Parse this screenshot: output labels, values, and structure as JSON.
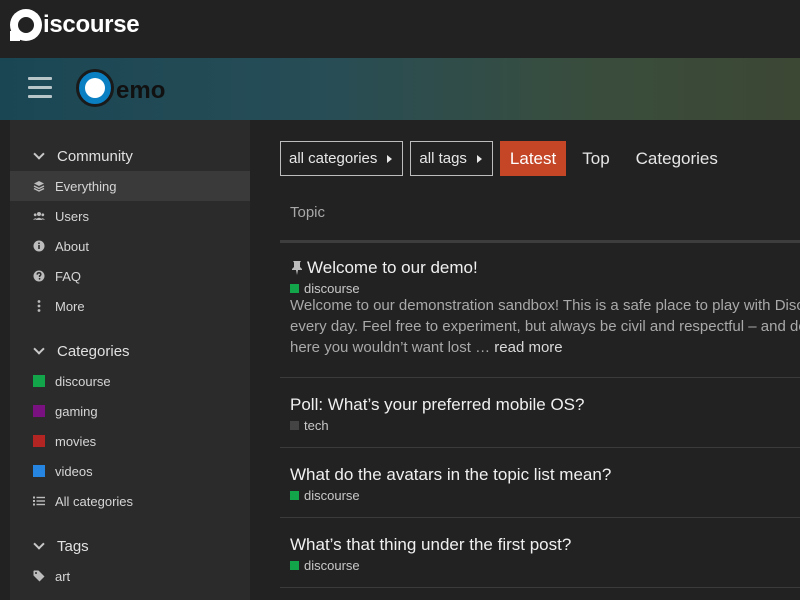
{
  "brand": {
    "name": "iscourse",
    "logo_icon": "discourse-logo-icon"
  },
  "header": {
    "menu_icon": "hamburger-icon",
    "site_logo_text": "emo",
    "site_logo_icon": "demo-bubble-icon"
  },
  "sidebar": {
    "sections": [
      {
        "title": "Community",
        "items": [
          {
            "label": "Everything",
            "icon": "layers-icon",
            "active": true
          },
          {
            "label": "Users",
            "icon": "users-icon"
          },
          {
            "label": "About",
            "icon": "info-icon"
          },
          {
            "label": "FAQ",
            "icon": "question-icon"
          },
          {
            "label": "More",
            "icon": "ellipsis-vertical-icon"
          }
        ]
      },
      {
        "title": "Categories",
        "items": [
          {
            "label": "discourse",
            "color": "#12a54a"
          },
          {
            "label": "gaming",
            "color": "#7a1181"
          },
          {
            "label": "movies",
            "color": "#b32523"
          },
          {
            "label": "videos",
            "color": "#2585e0"
          },
          {
            "label": "All categories",
            "icon": "list-icon"
          }
        ]
      },
      {
        "title": "Tags",
        "items": [
          {
            "label": "art",
            "icon": "tag-icon"
          }
        ]
      }
    ]
  },
  "filters": {
    "categories_dropdown": "all categories",
    "tags_dropdown": "all tags",
    "tabs": [
      "Latest",
      "Top",
      "Categories"
    ],
    "active_tab": "Latest"
  },
  "topic_list": {
    "column_header": "Topic",
    "topics": [
      {
        "title": "Welcome to our demo!",
        "pinned": true,
        "category": "discourse",
        "category_color": "#12a54a",
        "excerpt_lines": [
          "Welcome to our demonstration sandbox! This is a safe place to play with Disc",
          "every day. Feel free to experiment, but always be civil and respectful – and do",
          "here you wouldn’t want lost …"
        ],
        "read_more": "read more"
      },
      {
        "title": "Poll: What’s your preferred mobile OS?",
        "category": "tech",
        "category_color": "#444444"
      },
      {
        "title": "What do the avatars in the topic list mean?",
        "category": "discourse",
        "category_color": "#12a54a"
      },
      {
        "title": "What’s that thing under the first post?",
        "category": "discourse",
        "category_color": "#12a54a"
      }
    ]
  }
}
